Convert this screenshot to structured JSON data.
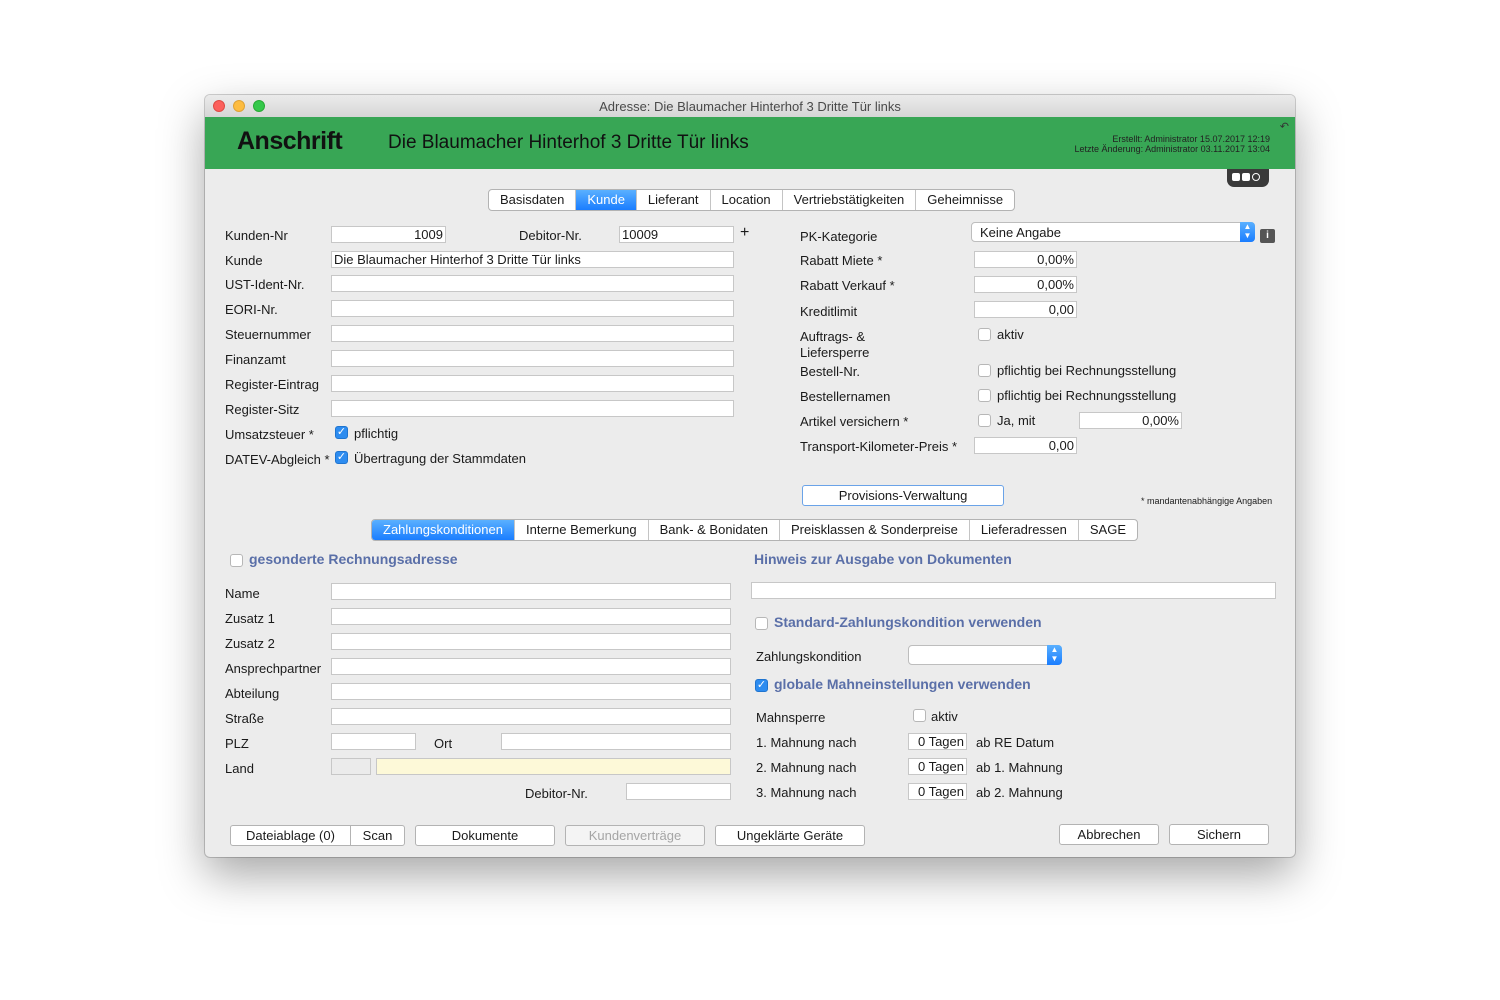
{
  "window": {
    "title": "Adresse: Die Blaumacher Hinterhof 3 Dritte Tür links"
  },
  "header": {
    "title": "Anschrift",
    "name": "Die Blaumacher Hinterhof 3 Dritte Tür links",
    "created": "Erstellt: Administrator 15.07.2017 12:19",
    "modified": "Letzte Änderung: Administrator 03.11.2017 13:04",
    "color": "#38a655"
  },
  "main_tabs": [
    "Basisdaten",
    "Kunde",
    "Lieferant",
    "Location",
    "Vertriebstätigkeiten",
    "Geheimnisse"
  ],
  "main_tab_active": "Kunde",
  "left_form": {
    "kunden_nr_label": "Kunden-Nr",
    "kunden_nr": "1009",
    "debitor_label": "Debitor-Nr.",
    "debitor": "10009",
    "plus": "+",
    "kunde_label": "Kunde",
    "kunde": "Die Blaumacher Hinterhof 3 Dritte Tür links",
    "ust_label": "UST-Ident-Nr.",
    "eori_label": "EORI-Nr.",
    "steuer_label": "Steuernummer",
    "finanzamt_label": "Finanzamt",
    "register_eintrag_label": "Register-Eintrag",
    "register_sitz_label": "Register-Sitz",
    "umsatz_label": "Umsatzsteuer *",
    "umsatz_check": "pflichtig",
    "datev_label": "DATEV-Abgleich *",
    "datev_check": "Übertragung der Stammdaten"
  },
  "right_form": {
    "pk_label": "PK-Kategorie",
    "pk_value": "Keine Angabe",
    "rabatt_miete_label": "Rabatt Miete *",
    "rabatt_miete": "0,00%",
    "rabatt_verkauf_label": "Rabatt Verkauf *",
    "rabatt_verkauf": "0,00%",
    "kreditlimit_label": "Kreditlimit",
    "kreditlimit": "0,00",
    "sperre_label_1": "Auftrags- &",
    "sperre_label_2": "Liefersperre",
    "sperre_check": "aktiv",
    "bestell_nr_label": "Bestell-Nr.",
    "bestell_nr_check": "pflichtig bei Rechnungsstellung",
    "bestellernamen_label": "Bestellernamen",
    "bestellernamen_check": "pflichtig bei Rechnungsstellung",
    "artikel_label": "Artikel versichern *",
    "artikel_check": "Ja, mit",
    "artikel_value": "0,00%",
    "transport_label": "Transport-Kilometer-Preis *",
    "transport_value": "0,00",
    "provision_button": "Provisions-Verwaltung",
    "note": "* mandantenabhängige Angaben"
  },
  "sub_tabs": [
    "Zahlungskonditionen",
    "Interne Bemerkung",
    "Bank- & Bonidaten",
    "Preisklassen & Sonderpreise",
    "Lieferadressen",
    "SAGE"
  ],
  "sub_tab_active": "Zahlungskonditionen",
  "billing": {
    "heading": "gesonderte Rechnungsadresse",
    "name_label": "Name",
    "zusatz1_label": "Zusatz 1",
    "zusatz2_label": "Zusatz 2",
    "ansprech_label": "Ansprechpartner",
    "abteilung_label": "Abteilung",
    "strasse_label": "Straße",
    "plz_label": "PLZ",
    "ort_label": "Ort",
    "land_label": "Land",
    "debitor_label": "Debitor-Nr."
  },
  "payment": {
    "hinweis_heading": "Hinweis zur Ausgabe von Dokumenten",
    "standard_heading": "Standard-Zahlungskondition verwenden",
    "zahlungskondition_label": "Zahlungskondition",
    "mahn_heading": "globale Mahneinstellungen verwenden",
    "mahnsperre_label": "Mahnsperre",
    "mahnsperre_check": "aktiv",
    "mahnungen": [
      {
        "label": "1. Mahnung nach",
        "value": "0 Tagen",
        "suffix": "ab RE Datum"
      },
      {
        "label": "2. Mahnung nach",
        "value": "0 Tagen",
        "suffix": "ab 1. Mahnung"
      },
      {
        "label": "3. Mahnung nach",
        "value": "0 Tagen",
        "suffix": "ab 2. Mahnung"
      }
    ]
  },
  "footer": {
    "dateiablage": "Dateiablage (0)",
    "scan": "Scan",
    "dokumente": "Dokumente",
    "kundenvertraege": "Kundenverträge",
    "geraete": "Ungeklärte Geräte",
    "abbrechen": "Abbrechen",
    "sichern": "Sichern"
  }
}
